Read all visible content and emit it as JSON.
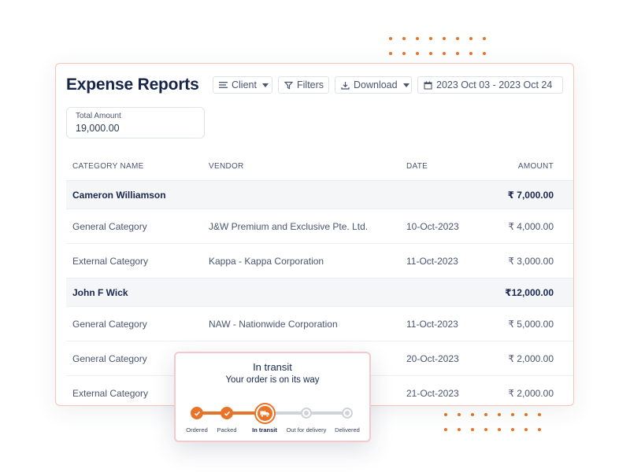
{
  "report": {
    "title": "Expense Reports",
    "filters": {
      "client_label": "Client",
      "filters_label": "Filters",
      "download_label": "Download",
      "date_range": "2023 Oct 03 - 2023 Oct 24"
    },
    "total": {
      "label": "Total Amount",
      "value": "19,000.00"
    },
    "columns": [
      "CATEGORY NAME",
      "VENDOR",
      "DATE",
      "AMOUNT"
    ],
    "groups": [
      {
        "name": "Cameron Williamson",
        "amount": "₹ 7,000.00",
        "rows": [
          {
            "category": "General Category",
            "vendor": "J&W Premium and Exclusive Pte. Ltd.",
            "date": "10-Oct-2023",
            "amount": "₹ 4,000.00"
          },
          {
            "category": "External Category",
            "vendor": "Kappa - Kappa Corporation",
            "date": "11-Oct-2023",
            "amount": "₹ 3,000.00"
          }
        ]
      },
      {
        "name": "John F Wick",
        "amount": "₹12,000.00",
        "rows": [
          {
            "category": "General Category",
            "vendor": "NAW - Nationwide Corporation",
            "date": "11-Oct-2023",
            "amount": "₹ 5,000.00"
          },
          {
            "category": "General Category",
            "vendor": "",
            "date": "20-Oct-2023",
            "amount": "₹ 2,000.00"
          },
          {
            "category": "External Category",
            "vendor": "",
            "date": "21-Oct-2023",
            "amount": "₹ 2,000.00"
          }
        ]
      }
    ]
  },
  "tracker": {
    "title": "In transit",
    "subtitle": "Your order is on its way",
    "steps": [
      {
        "label": "Ordered",
        "state": "done"
      },
      {
        "label": "Packed",
        "state": "done"
      },
      {
        "label": "In transit",
        "state": "current"
      },
      {
        "label": "Out for delivery",
        "state": "pending"
      },
      {
        "label": "Delivered",
        "state": "pending"
      }
    ]
  },
  "colors": {
    "accent": "#e8742a",
    "title": "#16244a",
    "pending": "#cfd3da"
  }
}
